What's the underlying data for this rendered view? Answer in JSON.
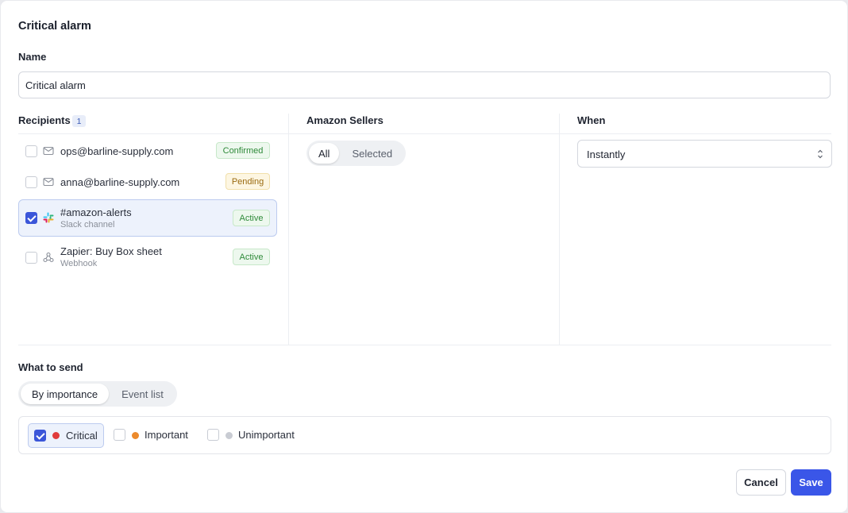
{
  "dialog": {
    "title": "Critical alarm"
  },
  "name_field": {
    "label": "Name",
    "value": "Critical alarm"
  },
  "recipients": {
    "label": "Recipients",
    "count": "1",
    "items": [
      {
        "name": "ops@barline-supply.com",
        "subtitle": "",
        "icon": "mail-icon",
        "status": "Confirmed",
        "checked": false
      },
      {
        "name": "anna@barline-supply.com",
        "subtitle": "",
        "icon": "mail-icon",
        "status": "Pending",
        "checked": false
      },
      {
        "name": "#amazon-alerts",
        "subtitle": "Slack channel",
        "icon": "slack-icon",
        "status": "Active",
        "checked": true
      },
      {
        "name": "Zapier: Buy Box sheet",
        "subtitle": "Webhook",
        "icon": "webhook-icon",
        "status": "Active",
        "checked": false
      }
    ]
  },
  "sellers": {
    "label": "Amazon Sellers",
    "options": [
      "All",
      "Selected"
    ],
    "selected": "All"
  },
  "when": {
    "label": "When",
    "value": "Instantly"
  },
  "what_to_send": {
    "label": "What to send",
    "tabs": [
      "By importance",
      "Event list"
    ],
    "active_tab": "By importance",
    "importance": [
      {
        "label": "Critical",
        "color": "#e03b3b",
        "checked": true
      },
      {
        "label": "Important",
        "color": "#ec8a2c",
        "checked": false
      },
      {
        "label": "Unimportant",
        "color": "#c9ccd3",
        "checked": false
      }
    ]
  },
  "footer": {
    "cancel": "Cancel",
    "save": "Save"
  },
  "colors": {
    "primary": "#3a56e8",
    "selected_bg": "#edf2fc"
  }
}
